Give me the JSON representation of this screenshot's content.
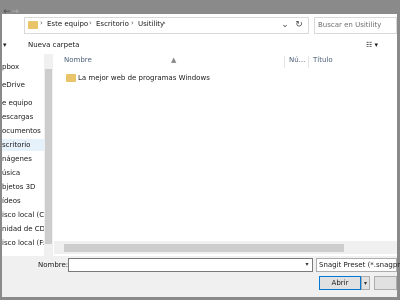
{
  "nav": {
    "back_glyph": "←",
    "forward_glyph": "→",
    "recent_glyph": "⌄",
    "up_glyph": "↑",
    "breadcrumb": [
      "Este equipo",
      "Escritorio",
      "Usitility"
    ],
    "separator": "›",
    "refresh_glyph": "↻",
    "addr_drop_glyph": "⌄"
  },
  "search": {
    "placeholder": "Buscar en Usitility"
  },
  "toolbar": {
    "organize_glyph": "▾",
    "new_folder": "Nueva carpeta",
    "view_glyph": "☷ ▾",
    "pane_glyph": "▭",
    "help_glyph": "?"
  },
  "sidebar": {
    "items": [
      {
        "label": "pbox"
      },
      {
        "label": "eDrive"
      },
      {
        "label": "e equipo"
      },
      {
        "label": "escargas"
      },
      {
        "label": "ocumentos"
      },
      {
        "label": "scritorio",
        "selected": true
      },
      {
        "label": "nágenes"
      },
      {
        "label": "úsica"
      },
      {
        "label": "bjetos 3D"
      },
      {
        "label": "ídeos"
      },
      {
        "label": "isco local (C:)"
      },
      {
        "label": "nidad de CD (D"
      },
      {
        "label": "isco local (F:)"
      }
    ]
  },
  "columns": {
    "name": "Nombre",
    "number": "Nú...",
    "title": "Título"
  },
  "files": [
    {
      "name": "La mejor web de programas Windows",
      "icon": "folder-icon"
    }
  ],
  "footer": {
    "name_label": "Nombre:",
    "name_value": "",
    "filter": "Snagit Preset (*.snagprof,*",
    "open": "Abrir",
    "dropdown_glyph": "▾"
  },
  "colors": {
    "folder": "#e9c468",
    "selection": "#e5f1fb",
    "focus_border": "#0078d7",
    "frame": "#8a8a8a"
  }
}
